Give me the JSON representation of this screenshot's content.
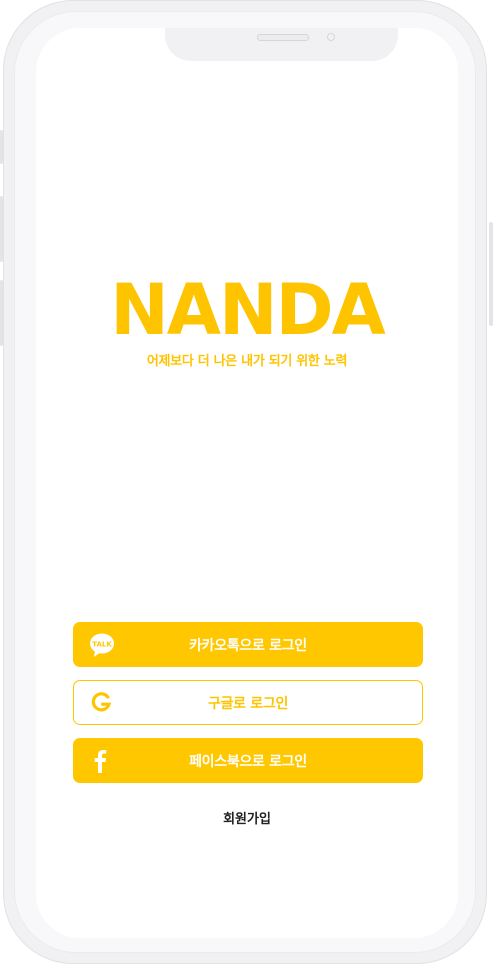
{
  "app": {
    "logo_text": "NANDA",
    "tagline": "어제보다 더 나은 내가 되기 위한 노력"
  },
  "login": {
    "kakao_label": "카카오톡으로 로그인",
    "kakao_icon_text": "TALK",
    "google_label": "구글로 로그인",
    "facebook_label": "페이스북으로 로그인"
  },
  "signup_label": "회원가입",
  "colors": {
    "brand": "#ffc400",
    "button_fill": "#ffc700",
    "button_text": "#ffffff"
  },
  "icons": {
    "kakao": "kakao-talk-icon",
    "google": "google-icon",
    "facebook": "facebook-icon"
  }
}
